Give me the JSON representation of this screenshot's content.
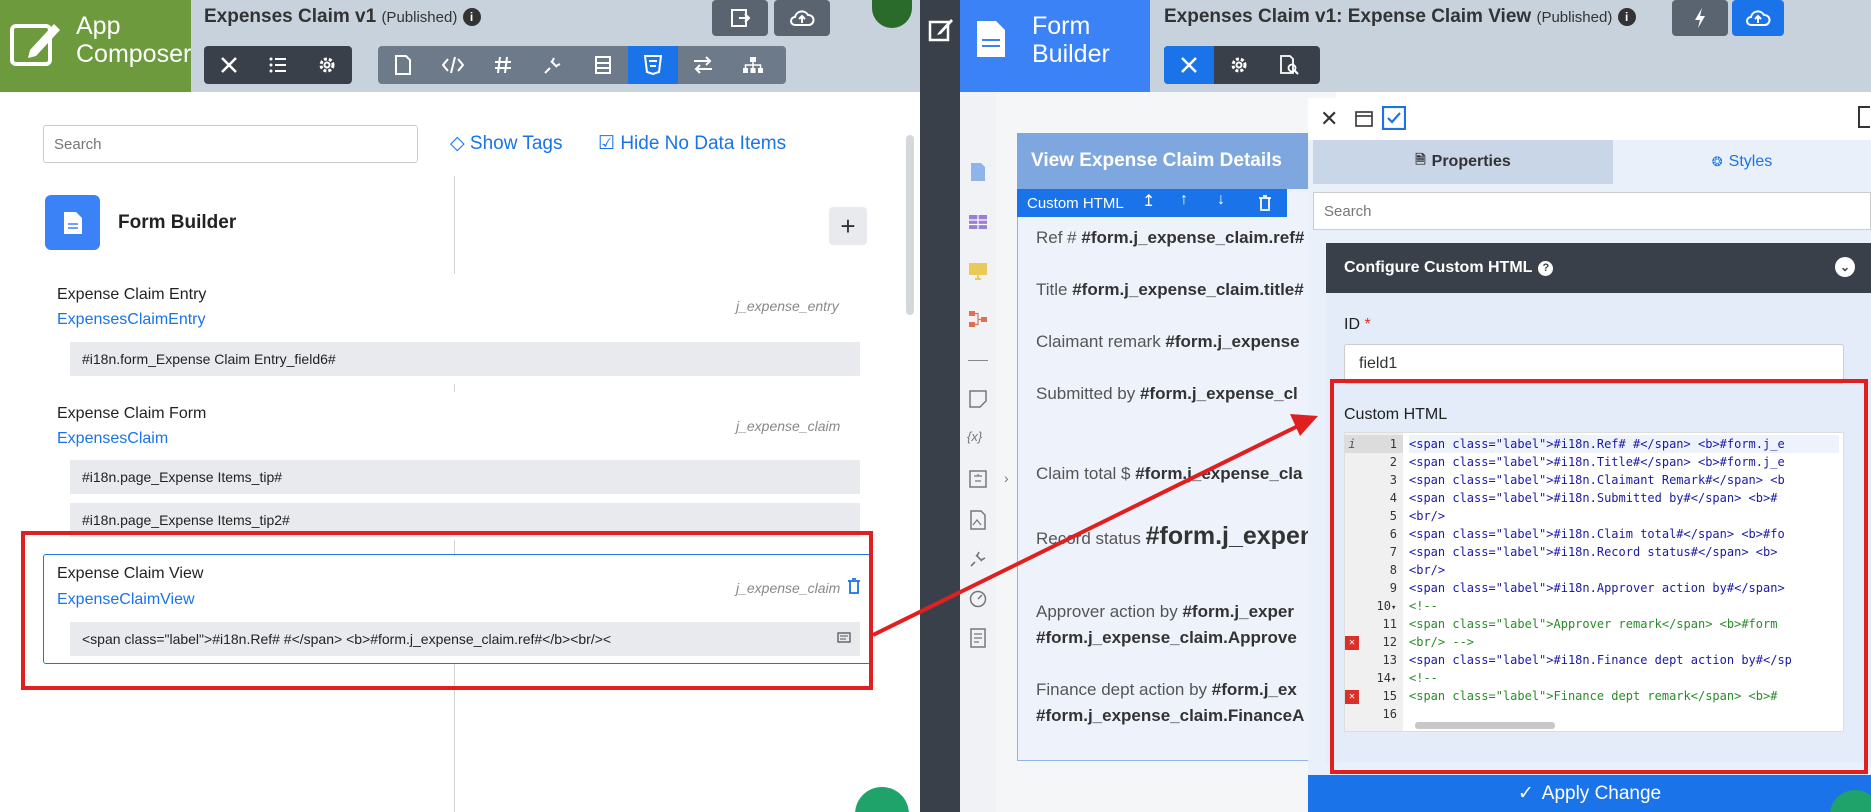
{
  "left": {
    "logo_line1": "App",
    "logo_line2": "Composer",
    "title": "Expenses Claim v1",
    "status": "(Published)",
    "search_placeholder": "Search",
    "show_tags": "Show Tags",
    "hide_no_data": "Hide No Data Items",
    "section_title": "Form Builder",
    "items": [
      {
        "title": "Expense Claim Entry",
        "link": "ExpensesClaimEntry",
        "table": "j_expense_entry",
        "bars": [
          "#i18n.form_Expense Claim Entry_field6#"
        ]
      },
      {
        "title": "Expense Claim Form",
        "link": "ExpensesClaim",
        "table": "j_expense_claim",
        "bars": [
          "#i18n.page_Expense Items_tip#",
          "#i18n.page_Expense Items_tip2#"
        ]
      },
      {
        "title": "Expense Claim View",
        "link": "ExpenseClaimView",
        "table": "j_expense_claim",
        "bars": [
          "<span class=\"label\">#i18n.Ref# #</span> <b>#form.j_expense_claim.ref#</b><br/><"
        ]
      }
    ]
  },
  "right": {
    "logo_line1": "Form",
    "logo_line2": "Builder",
    "title": "Expenses Claim v1: Expense Claim View",
    "status": "(Published)",
    "form_header": "View Expense Claim Details",
    "custom_html_label": "Custom HTML",
    "form_rows": [
      {
        "label": "Ref # ",
        "value": "#form.j_expense_claim.ref#"
      },
      {
        "label": "Title ",
        "value": "#form.j_expense_claim.title#"
      },
      {
        "label": "Claimant remark ",
        "value": "#form.j_expense"
      },
      {
        "label": "Submitted by ",
        "value": "#form.j_expense_cl"
      },
      {
        "label": "Claim total $ ",
        "value": "#form.j_expense_cla"
      },
      {
        "label": "Record status ",
        "value": "#form.j_expen"
      },
      {
        "label": "Approver action by ",
        "value": "#form.j_exper"
      },
      {
        "label": "",
        "value": "#form.j_expense_claim.Approve"
      },
      {
        "label": "Finance dept action by ",
        "value": "#form.j_ex"
      },
      {
        "label": "",
        "value": "#form.j_expense_claim.FinanceA"
      }
    ],
    "tab_properties": "Properties",
    "tab_styles": "Styles",
    "search_placeholder": "Search",
    "config_title": "Configure Custom HTML",
    "id_label": "ID",
    "id_required": "*",
    "id_value": "field1",
    "custom_html_title": "Custom HTML",
    "code_lines": [
      "<span class=\"label\">#i18n.Ref# #</span>  <b>#form.j_e",
      "<span class=\"label\">#i18n.Title#</span>  <b>#form.j_e",
      "<span class=\"label\">#i18n.Claimant Remark#</span>  <b",
      "<span class=\"label\">#i18n.Submitted by#</span>  <b>#",
      "<br/>",
      "<span class=\"label\">#i18n.Claim total#</span>  <b>#fo",
      "<span class=\"label\">#i18n.Record status#</span>  <b>",
      "<br/>",
      "<span class=\"label\">#i18n.Approver action by#</span> ",
      "<!--",
      "<span class=\"label\">Approver remark</span>  <b>#form",
      "<br/> -->",
      "<span class=\"label\">#i18n.Finance dept action by#</sp",
      "<!--",
      "<span class=\"label\">Finance dept remark</span>  <b>#",
      ""
    ],
    "apply_label": "Apply Change"
  },
  "colors": {
    "accent": "#1a73e8",
    "app_composer": "#6c9a3d",
    "form_builder": "#3b82f6",
    "annotation": "#e02020",
    "error": "#d9302c"
  }
}
